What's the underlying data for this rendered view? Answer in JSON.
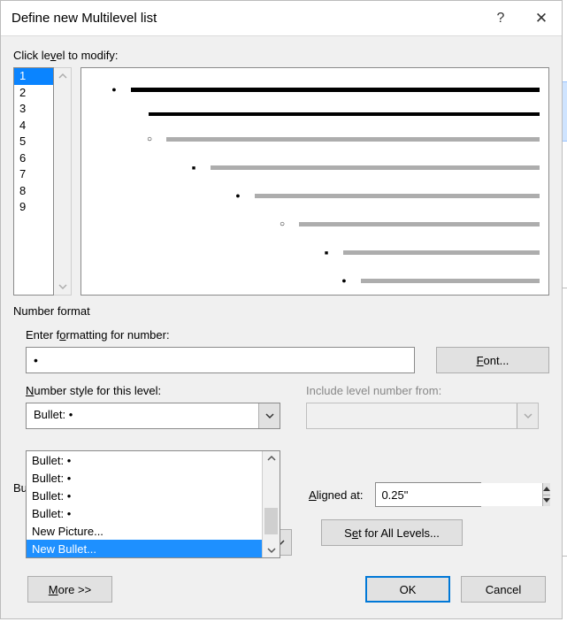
{
  "dialog": {
    "title": "Define new Multilevel list",
    "help_icon": "?",
    "close_icon": "✕"
  },
  "levels": {
    "label": "Click level to modify:",
    "items": [
      "1",
      "2",
      "3",
      "4",
      "5",
      "6",
      "7",
      "8",
      "9"
    ],
    "selected_index": 0
  },
  "preview": {
    "lines": [
      {
        "indent": 20,
        "marker": "fill",
        "style": "thick"
      },
      {
        "indent": 40,
        "marker": "",
        "style": "thick2"
      },
      {
        "indent": 60,
        "marker": "hollow",
        "style": "grey"
      },
      {
        "indent": 110,
        "marker": "square",
        "style": "grey"
      },
      {
        "indent": 160,
        "marker": "fill",
        "style": "grey"
      },
      {
        "indent": 210,
        "marker": "hollow",
        "style": "grey"
      },
      {
        "indent": 260,
        "marker": "square",
        "style": "grey"
      },
      {
        "indent": 280,
        "marker": "fill",
        "style": "grey"
      },
      {
        "indent": 300,
        "marker": "hollow",
        "style": "grey"
      },
      {
        "indent": 320,
        "marker": "square",
        "style": "grey"
      }
    ]
  },
  "number_format": {
    "group_label": "Number format",
    "enter_label": "Enter formatting for number:",
    "value": "•",
    "font_button": "Font...",
    "style_label": "Number style for this level:",
    "style_value": "Bullet: •",
    "include_label": "Include level number from:",
    "include_value": "",
    "dropdown_items": [
      "Bullet: •",
      "Bullet: •",
      "Bullet: •",
      "Bullet: •",
      "New Picture...",
      "New Bullet..."
    ],
    "dropdown_selected_index": 5
  },
  "position": {
    "bullet_label_fragment": "Bu",
    "aligned_label": "Aligned at:",
    "aligned_value": "0.25\"",
    "set_all_button": "Set for All Levels..."
  },
  "footer": {
    "more": "More >>",
    "ok": "OK",
    "cancel": "Cancel"
  }
}
